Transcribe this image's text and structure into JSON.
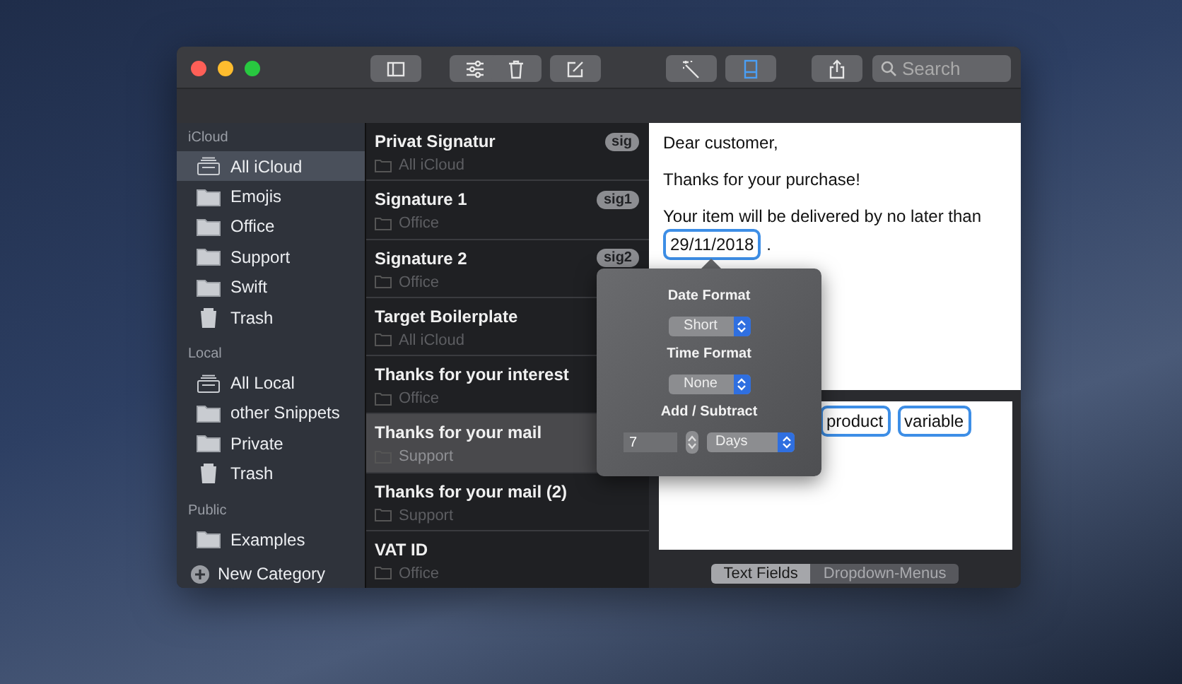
{
  "toolbar": {
    "buttons": [
      {
        "kind": "sidebar",
        "selected": false
      },
      {
        "kind": "sliders",
        "selected": false
      },
      {
        "kind": "trash",
        "selected": false
      },
      {
        "kind": "compose",
        "selected": false
      },
      {
        "kind": "wand",
        "selected": false
      },
      {
        "kind": "layout",
        "selected": true
      },
      {
        "kind": "share",
        "selected": false
      }
    ],
    "search": {
      "placeholder": "Search"
    }
  },
  "sidebar": {
    "sections": [
      {
        "title": "iCloud",
        "items": [
          {
            "label": "All iCloud",
            "kind": "stack",
            "selected": true
          },
          {
            "label": "Emojis",
            "kind": "folder",
            "selected": false
          },
          {
            "label": "Office",
            "kind": "folder",
            "selected": false
          },
          {
            "label": "Support",
            "kind": "folder",
            "selected": false
          },
          {
            "label": "Swift",
            "kind": "folder",
            "selected": false
          },
          {
            "label": "Trash",
            "kind": "trash",
            "selected": false
          }
        ]
      },
      {
        "title": "Local",
        "items": [
          {
            "label": "All Local",
            "kind": "stack",
            "selected": false
          },
          {
            "label": "other Snippets",
            "kind": "folder",
            "selected": false
          },
          {
            "label": "Private",
            "kind": "folder",
            "selected": false
          },
          {
            "label": "Trash",
            "kind": "trash",
            "selected": false
          }
        ]
      },
      {
        "title": "Public",
        "items": [
          {
            "label": "Examples",
            "kind": "folder",
            "selected": false
          }
        ]
      }
    ],
    "new_category": "New Category"
  },
  "snippets": [
    {
      "title": "Privat Signatur",
      "folder": "All iCloud",
      "badge": "sig",
      "selected": false
    },
    {
      "title": "Signature 1",
      "folder": "Office",
      "badge": "sig1",
      "selected": false
    },
    {
      "title": "Signature 2",
      "folder": "Office",
      "badge": "sig2",
      "selected": false
    },
    {
      "title": "Target Boilerplate",
      "folder": "All iCloud",
      "selected": false
    },
    {
      "title": "Thanks for your interest",
      "folder": "Office",
      "selected": false
    },
    {
      "title": "Thanks for your mail",
      "folder": "Support",
      "selected": true
    },
    {
      "title": "Thanks for your mail (2)",
      "folder": "Support",
      "selected": false
    },
    {
      "title": "VAT ID",
      "folder": "Office",
      "selected": false
    }
  ],
  "editor": {
    "greeting": "Dear customer,",
    "line_2": "Thanks for your purchase!",
    "line_3": "Your item will be delivered by no later than",
    "date_token": "29/11/2018",
    "after_token": ".",
    "bottom_tokens": [
      "product",
      "variable"
    ],
    "tabs": [
      {
        "label": "Text Fields",
        "selected": true
      },
      {
        "label": "Dropdown-Menus",
        "selected": false
      }
    ]
  },
  "popover": {
    "date_format_label": "Date Format",
    "date_format": "Short",
    "time_format_label": "Time Format",
    "time_format": "None",
    "add_subtract_label": "Add / Subtract",
    "amount": "7",
    "unit": "Days"
  }
}
